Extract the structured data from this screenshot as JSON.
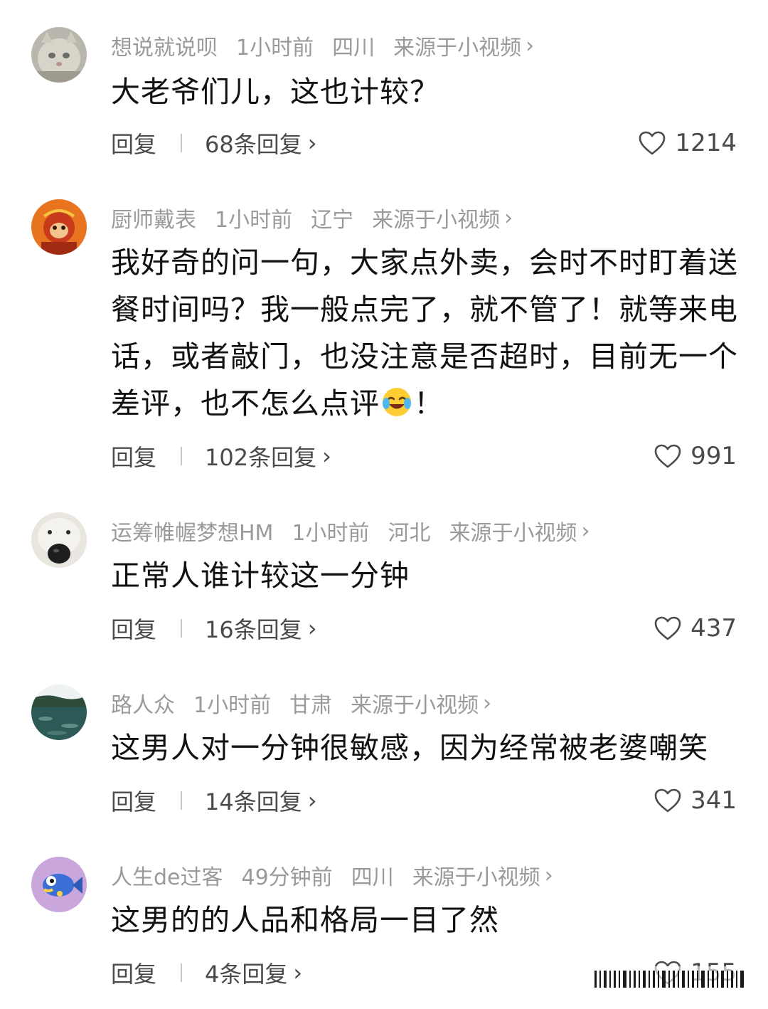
{
  "reply_label": "回复",
  "comments": [
    {
      "username": "想说就说呗",
      "time": "1小时前",
      "location": "四川",
      "source": "来源于小视频",
      "text": "大老爷们儿，这也计较？",
      "replies": "68条回复",
      "likes": "1214",
      "avatar": "cat-avatar"
    },
    {
      "username": "厨师戴表",
      "time": "1小时前",
      "location": "辽宁",
      "source": "来源于小视频",
      "text": "我好奇的问一句，大家点外卖，会时不时盯着送餐时间吗？我一般点完了，就不管了！就等来电话，或者敲门，也没注意是否超时，目前无一个差评，也不怎么点评",
      "text_suffix": "！",
      "emoji": "laughing-crying-emoji",
      "replies": "102条回复",
      "likes": "991",
      "avatar": "monkey-king-avatar"
    },
    {
      "username": "运筹帷幄梦想HM",
      "time": "1小时前",
      "location": "河北",
      "source": "来源于小视频",
      "text": "正常人谁计较这一分钟",
      "replies": "16条回复",
      "likes": "437",
      "avatar": "dog-avatar"
    },
    {
      "username": "路人众",
      "time": "1小时前",
      "location": "甘肃",
      "source": "来源于小视频",
      "text": "这男人对一分钟很敏感，因为经常被老婆嘲笑",
      "replies": "14条回复",
      "likes": "341",
      "avatar": "lake-avatar"
    },
    {
      "username": "人生de过客",
      "time": "49分钟前",
      "location": "四川",
      "source": "来源于小视频",
      "text": "这男的的人品和格局一目了然",
      "replies": "4条回复",
      "likes": "155",
      "avatar": "fish-avatar"
    }
  ],
  "icons": {
    "chevron": "chevron-right-icon",
    "like": "heart-outline-icon"
  },
  "colors": {
    "meta": "#9a9a9a",
    "body": "#111111",
    "action": "#4a4a4a"
  }
}
